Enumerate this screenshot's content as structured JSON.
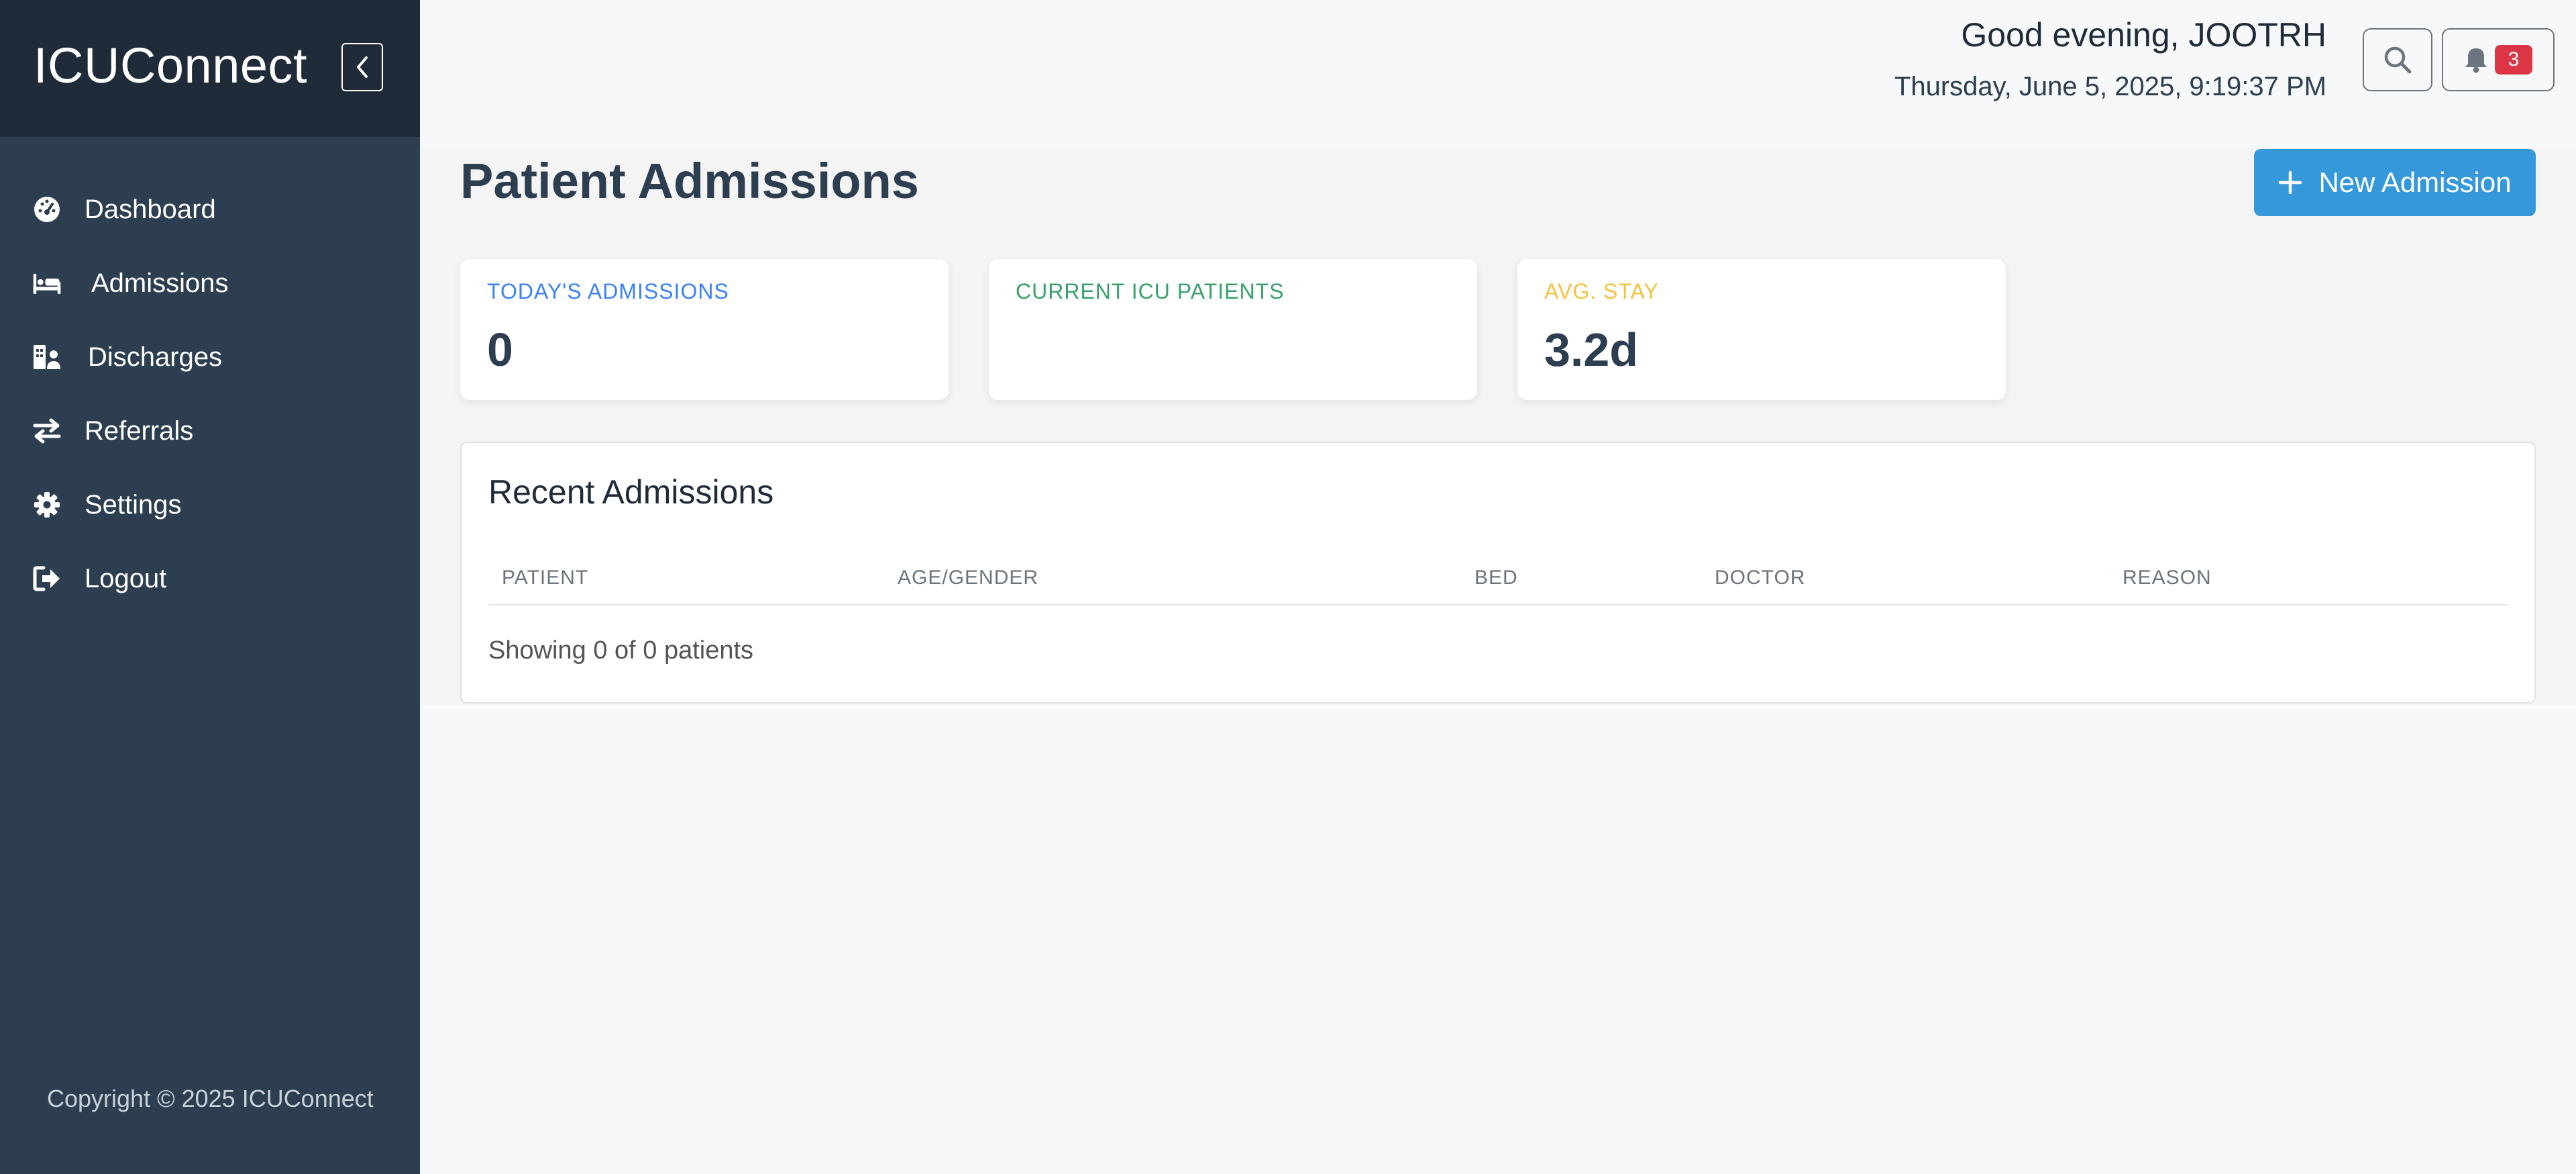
{
  "app": {
    "title": "ICUConnect",
    "copyright": "Copyright © 2025 ICUConnect"
  },
  "sidebar": {
    "items": [
      {
        "label": "Dashboard",
        "icon": "dashboard-icon"
      },
      {
        "label": "Admissions",
        "icon": "bed-icon"
      },
      {
        "label": "Discharges",
        "icon": "discharge-icon"
      },
      {
        "label": "Referrals",
        "icon": "exchange-icon"
      },
      {
        "label": "Settings",
        "icon": "gear-icon"
      },
      {
        "label": "Logout",
        "icon": "logout-icon"
      }
    ]
  },
  "header": {
    "greeting": "Good evening, JOOTRH",
    "datetime": "Thursday, June 5, 2025, 9:19:37 PM",
    "notifications_count": "3"
  },
  "main": {
    "page_title": "Patient Admissions",
    "new_admission_label": "New Admission",
    "stats": [
      {
        "label": "TODAY'S ADMISSIONS",
        "value": "0",
        "color": "#3b82f6"
      },
      {
        "label": "CURRENT ICU PATIENTS",
        "value": "",
        "color": "#38a169"
      },
      {
        "label": "AVG. STAY",
        "value": "3.2d",
        "color": "#f6c23e"
      }
    ],
    "table": {
      "title": "Recent Admissions",
      "columns": [
        "PATIENT",
        "AGE/GENDER",
        "BED",
        "DOCTOR",
        "REASON"
      ],
      "rows": [],
      "footer": "Showing 0 of 0 patients"
    }
  },
  "colors": {
    "sidebar_bg": "#2c3e50",
    "sidebar_header_bg": "#1f2b38",
    "accent": "#3498db",
    "badge": "#dc3545"
  }
}
